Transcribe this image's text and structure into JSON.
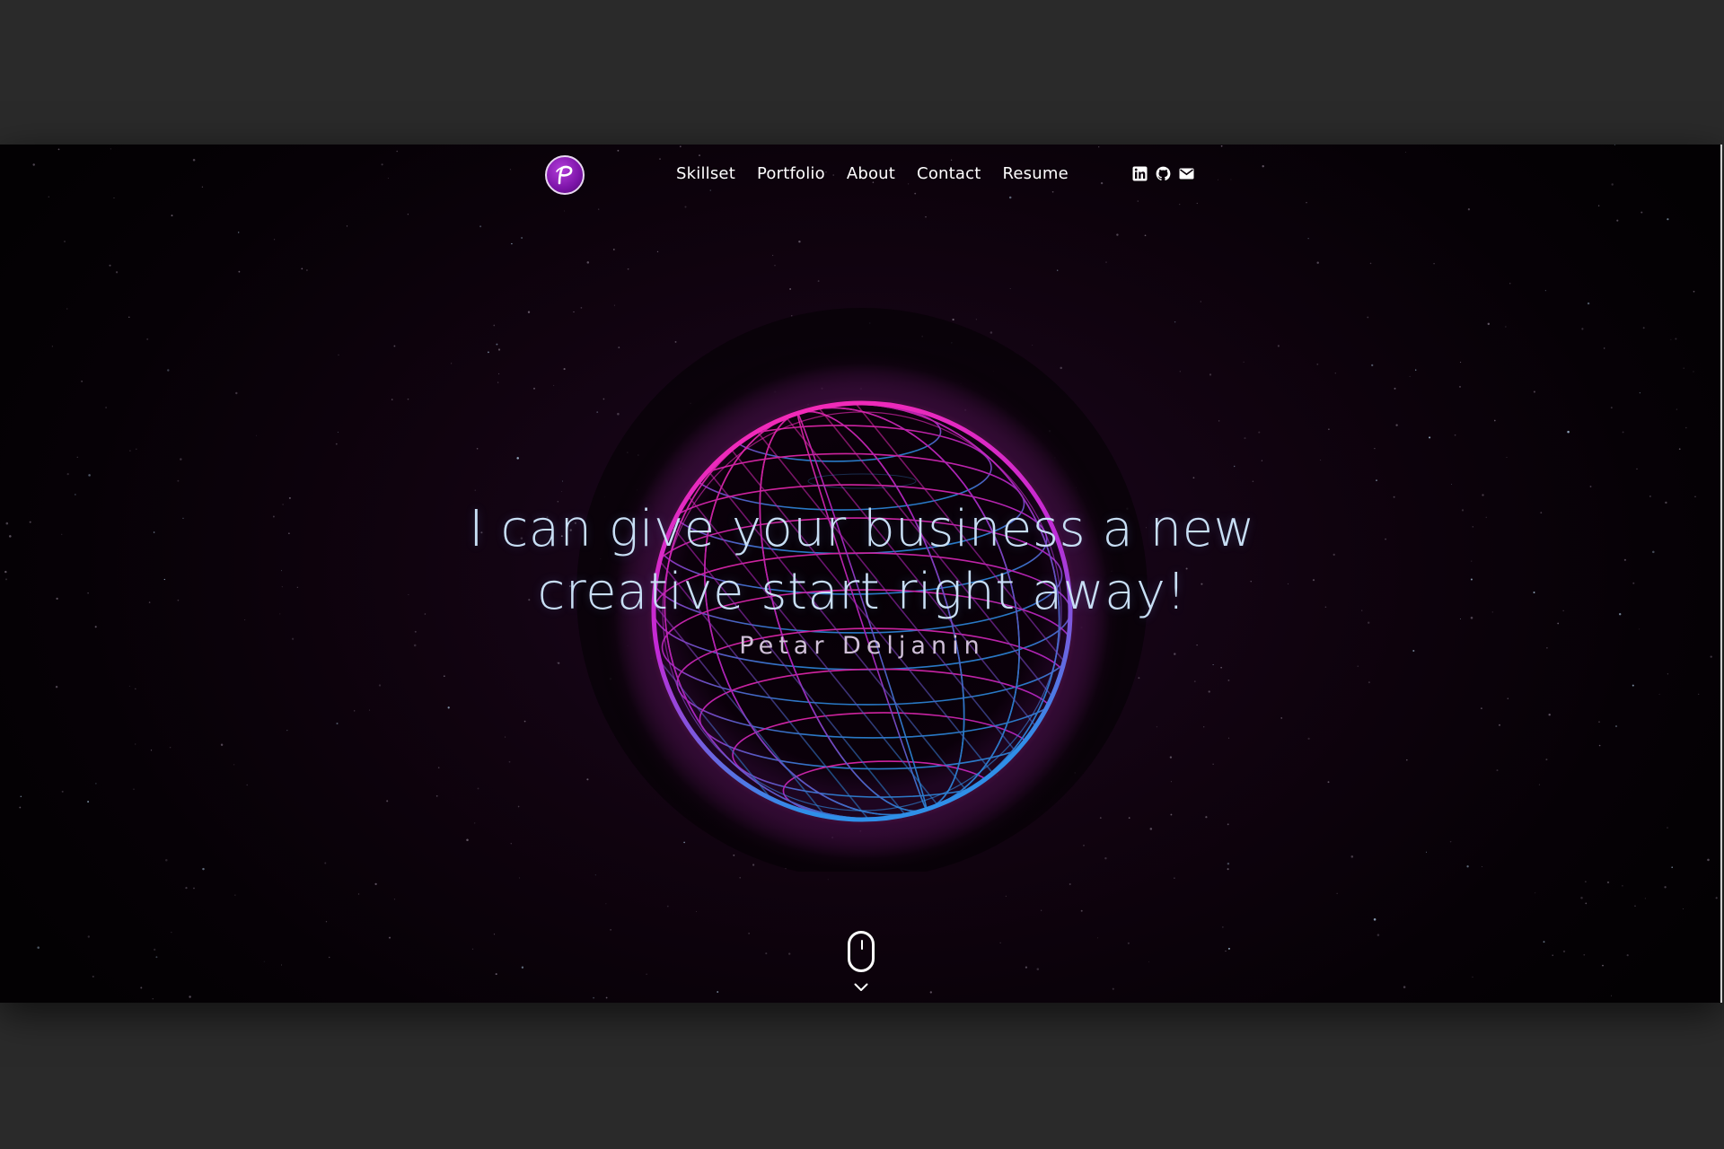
{
  "nav": {
    "logo_icon": "p-monogram-logo-icon",
    "items": [
      {
        "label": "Skillset"
      },
      {
        "label": "Portfolio"
      },
      {
        "label": "About"
      },
      {
        "label": "Contact"
      },
      {
        "label": "Resume"
      }
    ],
    "social": [
      {
        "icon": "linkedin-icon"
      },
      {
        "icon": "github-icon"
      },
      {
        "icon": "mail-icon"
      }
    ]
  },
  "hero": {
    "headline_line1": "I can give your business a new",
    "headline_line2": "creative start right away!",
    "name": "Petar Deljanin",
    "scroll_icon": "mouse-scroll-icon",
    "scroll_arrow_icon": "chevron-down-icon"
  },
  "colors": {
    "page_background": "#2a2a2a",
    "hero_background": "#0a020a",
    "accent_magenta": "#e0279a",
    "accent_blue": "#2f7fe0",
    "headline": "#c8dff5",
    "logo_purple": "#7c14a8"
  }
}
